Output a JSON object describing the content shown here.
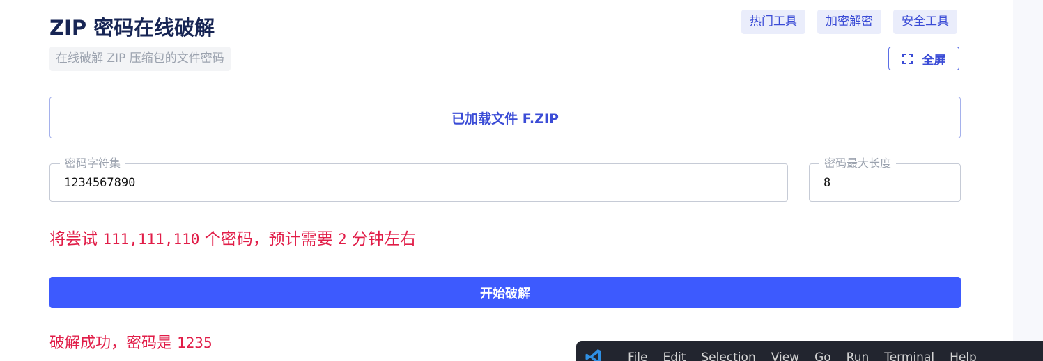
{
  "header": {
    "title": "ZIP 密码在线破解",
    "subtitle": "在线破解 ZIP 压缩包的文件密码"
  },
  "nav": {
    "items": [
      "热门工具",
      "加密解密",
      "安全工具"
    ],
    "fullscreen_label": "全屏"
  },
  "file": {
    "label": "已加载文件 F.ZIP"
  },
  "charset": {
    "label": "密码字符集",
    "value": "1234567890"
  },
  "max_length": {
    "label": "密码最大长度",
    "value": "8"
  },
  "estimate": {
    "prefix": "将尝试",
    "count": "111,111,110",
    "middle": "个密码，预计需要",
    "minutes": "2",
    "suffix": "分钟左右"
  },
  "start_button": {
    "label": "开始破解"
  },
  "result": {
    "prefix": "破解成功，密码是",
    "password": "1235"
  },
  "vscode": {
    "menu": [
      "File",
      "Edit",
      "Selection",
      "View",
      "Go",
      "Run",
      "Terminal",
      "Help"
    ]
  },
  "colors": {
    "title": "#172554",
    "accent": "#3d5afe",
    "link": "#3b4cd6",
    "alert": "#e11d48",
    "vscode_bg": "#22252f"
  }
}
